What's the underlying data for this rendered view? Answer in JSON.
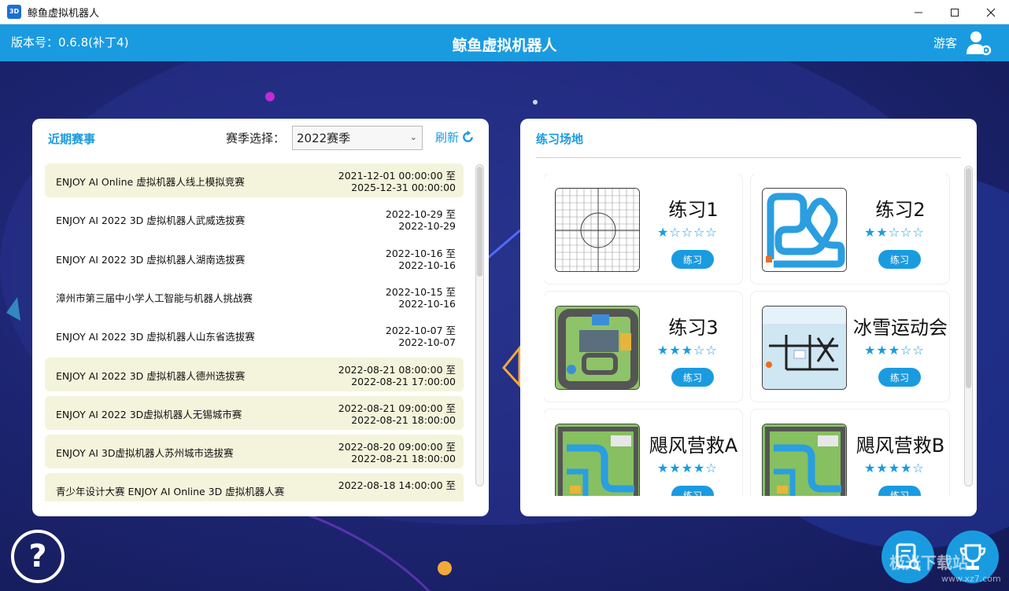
{
  "window": {
    "title": "鲸鱼虚拟机器人",
    "icon_text": "3D"
  },
  "header": {
    "version": "版本号：0.6.8(补丁4)",
    "title": "鲸鱼虚拟机器人",
    "user": "游客"
  },
  "events_panel": {
    "title": "近期赛事",
    "season_label": "赛季选择：",
    "season_value": "2022赛季",
    "refresh_label": "刷新",
    "events": [
      {
        "name": "ENJOY AI Online 虚拟机器人线上模拟竞赛",
        "start": "2021-12-01 00:00:00 至",
        "end": "2025-12-31 00:00:00",
        "highlight": true
      },
      {
        "name": "ENJOY AI 2022 3D 虚拟机器人武威选拔赛",
        "start": "2022-10-29  至",
        "end": "2022-10-29",
        "highlight": false
      },
      {
        "name": "ENJOY AI 2022  3D 虚拟机器人湖南选拔赛",
        "start": "2022-10-16  至",
        "end": "2022-10-16",
        "highlight": false
      },
      {
        "name": "漳州市第三届中小学人工智能与机器人挑战赛",
        "start": "2022-10-15  至",
        "end": "2022-10-16",
        "highlight": false
      },
      {
        "name": "ENJOY AI 2022 3D 虚拟机器人山东省选拔赛",
        "start": "2022-10-07  至",
        "end": "2022-10-07",
        "highlight": false
      },
      {
        "name": "ENJOY AI 2022 3D 虚拟机器人德州选拔赛",
        "start": "2022-08-21 08:00:00 至",
        "end": "2022-08-21 17:00:00",
        "highlight": true
      },
      {
        "name": "ENJOY AI 2022 3D虚拟机器人无锡城市赛",
        "start": "2022-08-21 09:00:00 至",
        "end": "2022-08-21 18:00:00",
        "highlight": true
      },
      {
        "name": "ENJOY AI 3D虚拟机器人苏州城市选拔赛",
        "start": "2022-08-20 09:00:00 至",
        "end": "2022-08-21 18:00:00",
        "highlight": true
      },
      {
        "name": "青少年设计大赛 ENJOY AI Online 3D 虚拟机器人赛",
        "start": "2022-08-18 14:00:00 至",
        "end": "",
        "highlight": true
      }
    ]
  },
  "practice_panel": {
    "title": "练习场地",
    "button_label": "练习",
    "fields": [
      {
        "name": "练习1",
        "stars": 1,
        "thumb": "grid"
      },
      {
        "name": "练习2",
        "stars": 2,
        "thumb": "track"
      },
      {
        "name": "练习3",
        "stars": 3,
        "thumb": "city"
      },
      {
        "name": "冰雪运动会",
        "stars": 3,
        "thumb": "snow"
      },
      {
        "name": "飓风营救A",
        "stars": 4,
        "thumb": "rescue"
      },
      {
        "name": "飓风营救B",
        "stars": 4,
        "thumb": "rescue"
      }
    ]
  },
  "help": {
    "symbol": "?"
  },
  "watermark": {
    "text": "极光下载站",
    "sub": "www.xz7.com"
  },
  "colors": {
    "accent": "#1a9be0",
    "background": "#1a2266",
    "highlight_row": "#f4f4dc"
  }
}
